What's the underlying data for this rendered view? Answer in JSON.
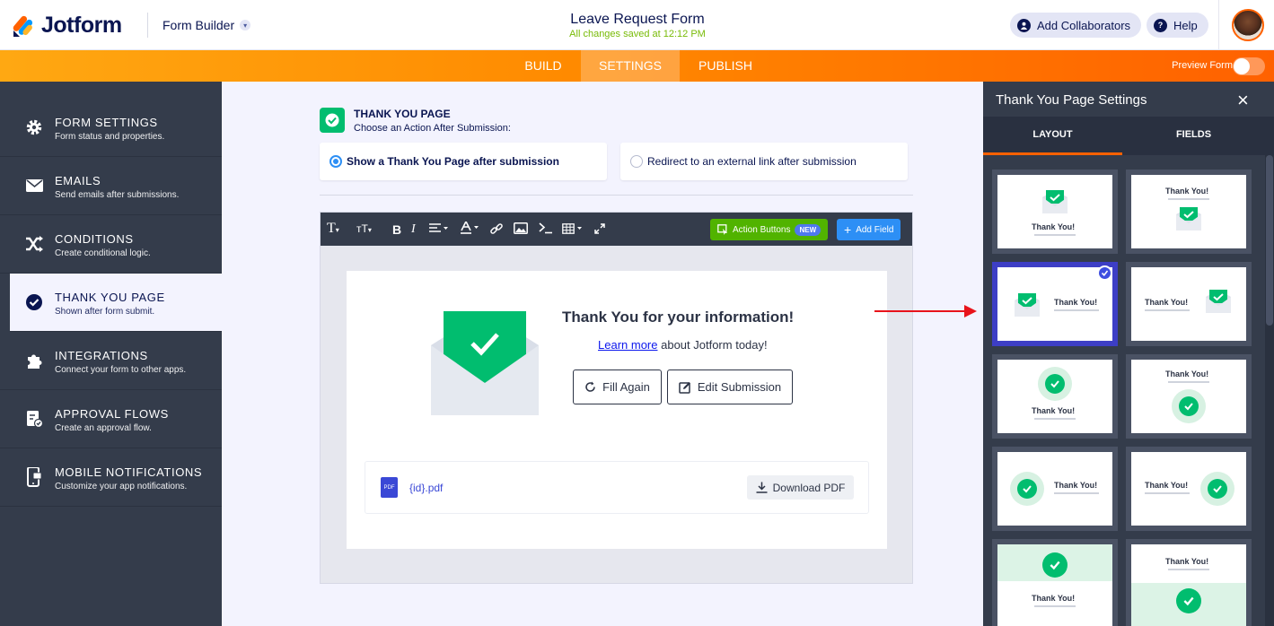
{
  "header": {
    "logo_text": "Jotform",
    "builder_label": "Form Builder",
    "form_title": "Leave Request Form",
    "saved_status": "All changes saved at 12:12 PM",
    "collaborators_label": "Add Collaborators",
    "help_label": "Help"
  },
  "nav": {
    "tabs": [
      "BUILD",
      "SETTINGS",
      "PUBLISH"
    ],
    "active": "SETTINGS",
    "preview_label": "Preview Form"
  },
  "sidebar": {
    "items": [
      {
        "title": "FORM SETTINGS",
        "subtitle": "Form status and properties.",
        "icon": "gear-icon"
      },
      {
        "title": "EMAILS",
        "subtitle": "Send emails after submissions.",
        "icon": "envelope-icon"
      },
      {
        "title": "CONDITIONS",
        "subtitle": "Create conditional logic.",
        "icon": "shuffle-icon"
      },
      {
        "title": "THANK YOU PAGE",
        "subtitle": "Shown after form submit.",
        "icon": "check-circle-icon",
        "active": true
      },
      {
        "title": "INTEGRATIONS",
        "subtitle": "Connect your form to other apps.",
        "icon": "puzzle-icon"
      },
      {
        "title": "APPROVAL FLOWS",
        "subtitle": "Create an approval flow.",
        "icon": "approval-icon"
      },
      {
        "title": "MOBILE NOTIFICATIONS",
        "subtitle": "Customize your app notifications.",
        "icon": "mobile-icon"
      }
    ]
  },
  "thankyou": {
    "title": "THANK YOU PAGE",
    "subtitle": "Choose an Action After Submission:",
    "option_show": "Show a Thank You Page after submission",
    "option_redirect": "Redirect to an external link after submission",
    "selected": "show"
  },
  "editor": {
    "action_buttons_label": "Action Buttons",
    "new_badge": "NEW",
    "add_field_label": "Add Field",
    "heading": "Thank You for your information!",
    "learn_link": "Learn more",
    "learn_rest": "about Jotform today!",
    "fill_again": "Fill Again",
    "edit_submission": "Edit Submission",
    "pdf_icon_label": "PDF",
    "pdf_name": "{id}.pdf",
    "download_pdf": "Download PDF"
  },
  "panel": {
    "title": "Thank You Page Settings",
    "tabs": [
      "LAYOUT",
      "FIELDS"
    ],
    "active_tab": "LAYOUT",
    "layout_text": "Thank You!",
    "selected_layout": 3
  },
  "colors": {
    "brand_orange": "#ff6100",
    "navy": "#0a1551",
    "sidebar_bg": "#343c4b",
    "success_green": "#01bd6f",
    "action_green": "#51b300",
    "blue": "#2d8ff5",
    "selected_border": "#3d3ec5"
  }
}
